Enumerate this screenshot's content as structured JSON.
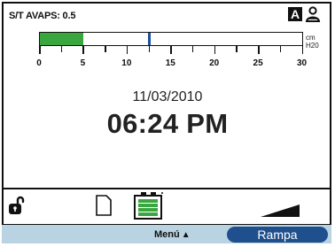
{
  "header": {
    "mode_label": "S/T AVAPS: 0.5",
    "badge_label": "A",
    "person_icon": "person-icon"
  },
  "gauge": {
    "min": 0,
    "max": 30,
    "fill_value": 5,
    "marker_value": 12.5,
    "fill_color": "#3aa640",
    "marker_color": "#1c4fa0",
    "tick_labels": [
      "0",
      "5",
      "10",
      "15",
      "20",
      "25",
      "30"
    ],
    "unit_line1": "cm",
    "unit_line2": "H20"
  },
  "clock": {
    "date": "11/03/2010",
    "time": "06:24 PM"
  },
  "status_icons": {
    "lock": "unlocked-padlock-icon",
    "card": "sd-card-icon",
    "battery": "battery-charging-icon",
    "ramp": "ramp-icon"
  },
  "bottom_bar": {
    "menu_label": "Menú",
    "menu_arrow": "▲",
    "ramp_label": "Rampa",
    "background_color": "#b9d3e2",
    "button_color": "#1f4f8c"
  }
}
